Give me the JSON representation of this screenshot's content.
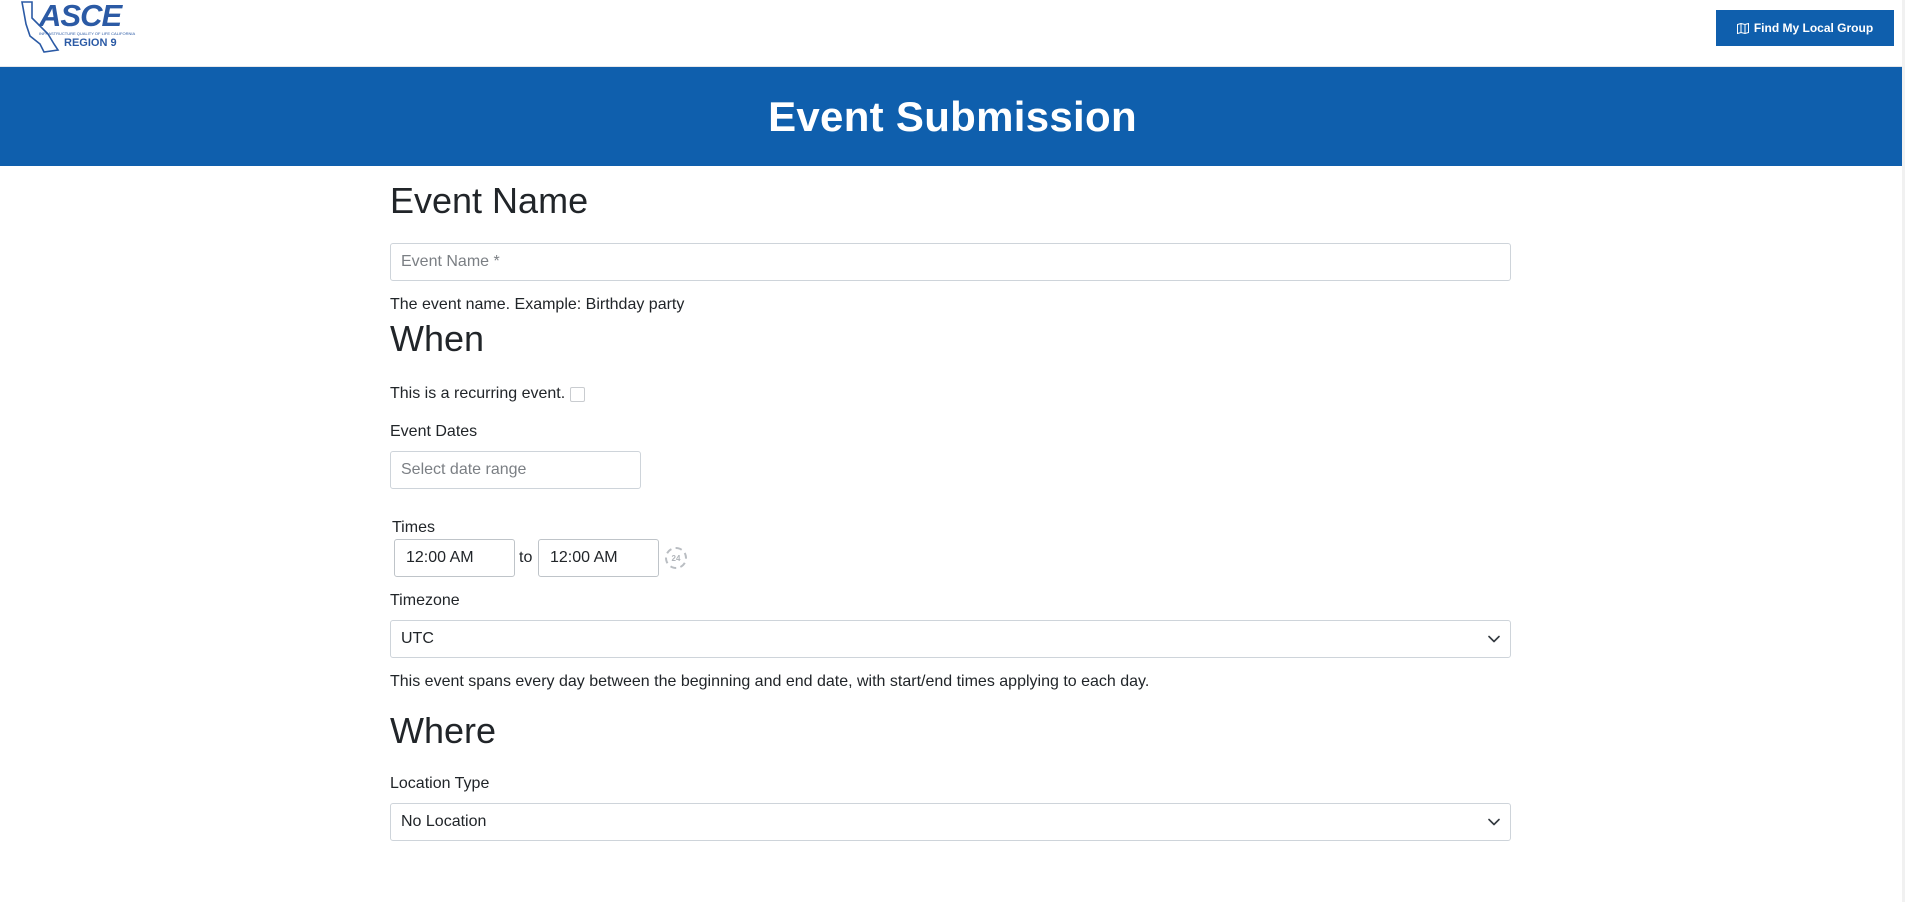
{
  "header": {
    "logo_text": "ASCE",
    "logo_tagline": "INFRASTRUCTURE QUALITY OF LIFE CALIFORNIA",
    "logo_region": "REGION 9",
    "find_group_label": "Find My Local Group",
    "find_group_icon": "map-icon"
  },
  "hero": {
    "title": "Event Submission"
  },
  "event_name": {
    "heading": "Event Name",
    "placeholder": "Event Name *",
    "value": "",
    "help": "The event name. Example: Birthday party"
  },
  "when": {
    "heading": "When",
    "recurring_label": "This is a recurring event.",
    "recurring_checked": false,
    "dates_label": "Event Dates",
    "dates_placeholder": "Select date range",
    "times_label": "Times",
    "start_time": "12:00 AM",
    "to_label": "to",
    "end_time": "12:00 AM",
    "format_toggle_text": "24",
    "timezone_label": "Timezone",
    "timezone_value": "UTC",
    "span_help": "This event spans every day between the beginning and end date, with start/end times applying to each day."
  },
  "where": {
    "heading": "Where",
    "location_type_label": "Location Type",
    "location_type_value": "No Location"
  },
  "colors": {
    "brand_blue": "#0f5fad",
    "logo_blue": "#2b5aa5",
    "border": "#ced4da"
  }
}
